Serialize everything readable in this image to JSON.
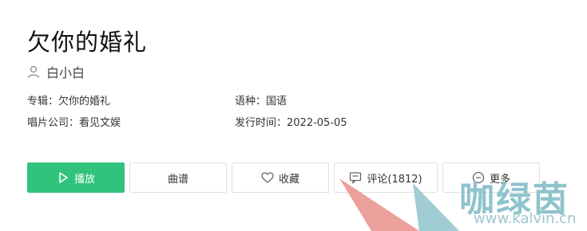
{
  "song": {
    "title": "欠你的婚礼",
    "artist": "白小白"
  },
  "info": {
    "album_label": "专辑：",
    "album_value": "欠你的婚礼",
    "language_label": "语种：",
    "language_value": "国语",
    "label_label": "唱片公司：",
    "label_value": "看见文娱",
    "release_label": "发行时间：",
    "release_value": "2022-05-05"
  },
  "actions": {
    "play": "播放",
    "score": "曲谱",
    "favorite": "收藏",
    "comments": "评论(1812)",
    "more": "更多"
  },
  "watermark": {
    "text": "咖绿茵",
    "url": "www.kalvin.cn"
  },
  "colors": {
    "primary": "#31c27c",
    "border": "#e1e1e1",
    "watermark_red": "#e98f8a",
    "watermark_teal": "#8fc3cd"
  },
  "icons": {
    "artist": "user-icon",
    "play": "play-icon",
    "favorite": "heart-icon",
    "comments": "comment-icon",
    "more": "more-icon"
  }
}
